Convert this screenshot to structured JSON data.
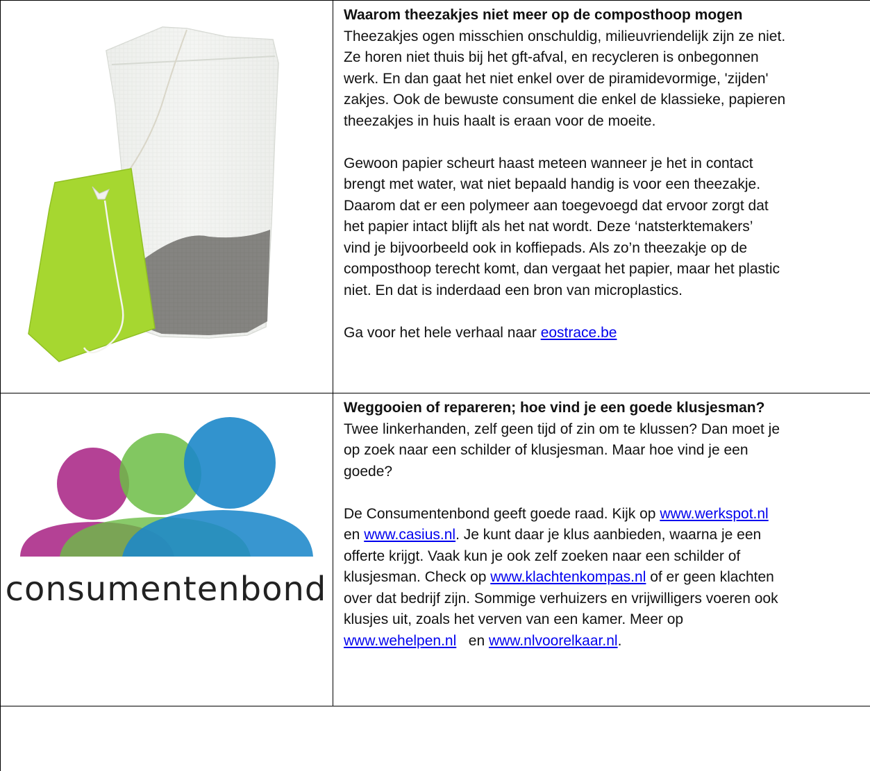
{
  "article1": {
    "title": "Waarom theezakjes niet meer op de composthoop mogen",
    "lines_p1": [
      "Theezakjes ogen misschien onschuldig, milieuvriendelijk zijn ze niet.",
      "Ze horen niet thuis bij het gft-afval, en recycleren is onbegonnen",
      "werk. En dan gaat het niet enkel over de piramidevormige, 'zijden'",
      "zakjes. Ook de bewuste consument die enkel de klassieke, papieren",
      "theezakjes in huis haalt is eraan voor de moeite."
    ],
    "lines_p2": [
      "Gewoon papier scheurt haast meteen wanneer je het in contact",
      "brengt met water, wat niet bepaald handig is voor een theezakje.",
      "Daarom dat er een polymeer aan toegevoegd dat ervoor zorgt dat",
      "het papier intact blijft als het nat wordt. Deze ‘natsterktemakers’",
      "vind je bijvoorbeeld ook in koffiepads. Als zo’n theezakje op de",
      "composthoop terecht komt, dan vergaat het papier, maar het plastic",
      "niet. En dat is inderdaad een bron van microplastics."
    ],
    "source_prefix": "Ga voor het hele verhaal naar ",
    "source_link": "eostrace.be"
  },
  "article2": {
    "title": "Weggooien of repareren; hoe vind je een goede klusjesman?",
    "lines_p1": [
      "Twee linkerhanden, zelf geen tijd of zin om te klussen? Dan moet je",
      "op zoek naar een schilder of klusjesman. Maar hoe vind je een",
      "goede?"
    ],
    "p2": {
      "l1_text": "De Consumentenbond geeft goede raad. Kijk op ",
      "l1_link": "www.werkspot.nl ",
      "l2_text_a": "en ",
      "l2_link": "www.casius.nl",
      "l2_text_b": ". Je kunt daar je klus aanbieden, waarna je een",
      "l3_text": "offerte krijgt. Vaak kun je ook zelf zoeken naar een schilder of",
      "l4_text_a": "klusjesman. Check op ",
      "l4_link": "www.klachtenkompas.nl",
      "l4_text_b": " of er geen klachten",
      "l5_text": "over dat bedrijf zijn. Sommige verhuizers en vrijwilligers voeren ook",
      "l6_text": "klusjes uit, zoals het verven van een kamer. Meer op",
      "l7_link_a": "www.wehelpen.nl",
      "l7_text": "   en ",
      "l7_link_b": "www.nlvoorelkaar.nl",
      "l7_end": "."
    },
    "logo_text": "consumentenbond"
  },
  "colors": {
    "tea_tag": "#a6d730",
    "logo_magenta": "#b0378f",
    "logo_green": "#6cbd45",
    "logo_blue": "#1c87c9",
    "link": "#0000ee"
  }
}
